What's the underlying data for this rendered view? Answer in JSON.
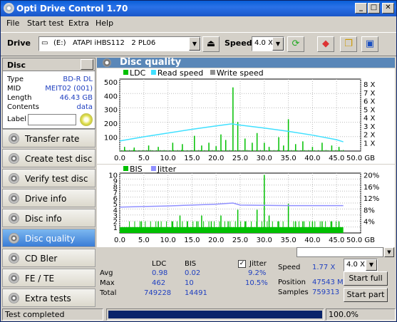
{
  "app": {
    "title": "Opti Drive Control 1.70",
    "min": "_",
    "max": "□",
    "close": "✕"
  },
  "menu": [
    "File",
    "Start test",
    "Extra",
    "Help"
  ],
  "toolbar": {
    "drive_label": "Drive",
    "drive_value": "(E:)   ATAPI iHBS112   2 PL06",
    "speed_label": "Speed",
    "speed_value": "4.0 X"
  },
  "disc": {
    "title": "Disc",
    "rows": [
      {
        "k": "Type",
        "v": "BD-R DL"
      },
      {
        "k": "MID",
        "v": "MEIT02 (001)"
      },
      {
        "k": "Length",
        "v": "46.43 GB"
      },
      {
        "k": "Contents",
        "v": "data"
      }
    ],
    "label_key": "Label"
  },
  "nav": [
    "Transfer rate",
    "Create test disc",
    "Verify test disc",
    "Drive info",
    "Disc info",
    "Disc quality",
    "CD Bler",
    "FE / TE",
    "Extra tests"
  ],
  "active_nav": "Disc quality",
  "panel_title": "Disc quality",
  "chart_data": [
    {
      "type": "line",
      "legend": [
        "LDC",
        "Read speed",
        "Write speed"
      ],
      "colors": {
        "LDC": "#00c000",
        "Read speed": "#40e0ff",
        "Write speed": "#909090"
      },
      "y_left": [
        100,
        200,
        300,
        400,
        500
      ],
      "y_right": [
        "1 X",
        "2 X",
        "3 X",
        "4 X",
        "5 X",
        "6 X",
        "7 X",
        "8 X"
      ],
      "x": [
        "0.0",
        "5.0",
        "10.0",
        "15.0",
        "20.0",
        "25.0",
        "30.0",
        "35.0",
        "40.0",
        "45.0",
        "50.0 GB"
      ],
      "ylim": [
        0,
        520
      ],
      "xlim": [
        0,
        50
      ],
      "read_speed": [
        [
          0,
          1.2
        ],
        [
          5,
          1.7
        ],
        [
          10,
          2.15
        ],
        [
          15,
          2.6
        ],
        [
          20,
          3.0
        ],
        [
          23.2,
          3.25
        ],
        [
          25,
          3.1
        ],
        [
          30,
          2.75
        ],
        [
          35,
          2.35
        ],
        [
          40,
          1.9
        ],
        [
          45,
          1.35
        ],
        [
          46.4,
          1.1
        ]
      ],
      "ldc_spikes": [
        [
          1,
          30
        ],
        [
          3,
          25
        ],
        [
          6,
          40
        ],
        [
          8,
          30
        ],
        [
          11,
          60
        ],
        [
          13,
          50
        ],
        [
          15.5,
          110
        ],
        [
          17,
          40
        ],
        [
          18.5,
          60
        ],
        [
          20,
          35
        ],
        [
          21,
          120
        ],
        [
          22,
          80
        ],
        [
          23.5,
          460
        ],
        [
          24.5,
          210
        ],
        [
          26,
          90
        ],
        [
          27.5,
          60
        ],
        [
          28.5,
          130
        ],
        [
          30,
          60
        ],
        [
          31,
          30
        ],
        [
          33,
          100
        ],
        [
          34,
          40
        ],
        [
          35,
          230
        ],
        [
          36.5,
          50
        ],
        [
          38,
          70
        ],
        [
          40,
          30
        ],
        [
          42,
          60
        ],
        [
          44,
          40
        ],
        [
          45.5,
          30
        ]
      ]
    },
    {
      "type": "bar",
      "legend": [
        "BIS",
        "Jitter"
      ],
      "colors": {
        "BIS": "#00c000",
        "Jitter": "#9090ff"
      },
      "y_left": [
        1,
        2,
        3,
        4,
        5,
        6,
        7,
        8,
        9,
        10
      ],
      "y_right": [
        "4%",
        "8%",
        "12%",
        "16%",
        "20%"
      ],
      "x": [
        "0.0",
        "5.0",
        "10.0",
        "15.0",
        "20.0",
        "25.0",
        "30.0",
        "35.0",
        "40.0",
        "45.0",
        "50.0 GB"
      ],
      "ylim": [
        0,
        10.3
      ],
      "xlim": [
        0,
        50
      ],
      "jitter": [
        [
          0,
          8.9
        ],
        [
          5,
          9.1
        ],
        [
          10,
          9.3
        ],
        [
          15,
          9.6
        ],
        [
          20,
          9.9
        ],
        [
          23.5,
          10.3
        ],
        [
          25,
          9.6
        ],
        [
          30,
          9.5
        ],
        [
          35,
          9.4
        ],
        [
          40,
          9.4
        ],
        [
          46.4,
          9.4
        ]
      ],
      "bis_spikes": [
        [
          4.5,
          2
        ],
        [
          8,
          2
        ],
        [
          11,
          2
        ],
        [
          12.5,
          3
        ],
        [
          14,
          2
        ],
        [
          16,
          2
        ],
        [
          17,
          3
        ],
        [
          19,
          2
        ],
        [
          21,
          3
        ],
        [
          22.5,
          2
        ],
        [
          24.5,
          4
        ],
        [
          26,
          2
        ],
        [
          28.5,
          4
        ],
        [
          30,
          10
        ],
        [
          31,
          3
        ],
        [
          33,
          2
        ],
        [
          35,
          5
        ],
        [
          36.5,
          2
        ],
        [
          38,
          2
        ],
        [
          40,
          2
        ],
        [
          42,
          2
        ],
        [
          44,
          2
        ],
        [
          45.5,
          2
        ]
      ]
    }
  ],
  "stats": {
    "headers": [
      "LDC",
      "BIS"
    ],
    "rows": [
      {
        "k": "Avg",
        "ldc": "0.98",
        "bis": "0.02",
        "jit": "9.2%"
      },
      {
        "k": "Max",
        "ldc": "462",
        "bis": "10",
        "jit": "10.5%"
      },
      {
        "k": "Total",
        "ldc": "749228",
        "bis": "14491",
        "jit": ""
      }
    ],
    "jitter_label": "Jitter",
    "speed_label": "Speed",
    "speed_val": "1.77 X",
    "position_label": "Position",
    "position_val": "47543 MB",
    "samples_label": "Samples",
    "samples_val": "759313",
    "speed_select": "4.0 X",
    "start_full": "Start full",
    "start_part": "Start part"
  },
  "status": {
    "text": "Test completed",
    "percent": "100.0%",
    "progress": 1.0
  }
}
